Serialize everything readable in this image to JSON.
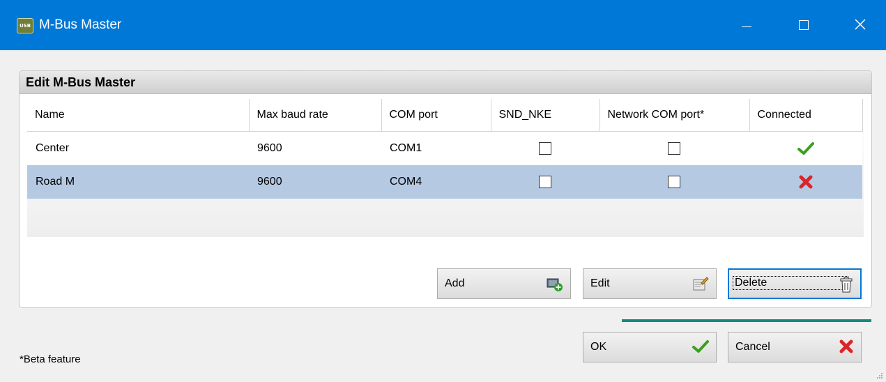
{
  "window": {
    "title": "M-Bus Master",
    "icon_text": "USB"
  },
  "panel": {
    "title": "Edit M-Bus Master"
  },
  "grid": {
    "columns": [
      "Name",
      "Max baud rate",
      "COM port",
      "SND_NKE",
      "Network COM port*",
      "Connected"
    ],
    "rows": [
      {
        "name": "Center",
        "baud": "9600",
        "port": "COM1",
        "snd_nke": false,
        "network": false,
        "connected": true
      },
      {
        "name": "Road M",
        "baud": "9600",
        "port": "COM4",
        "snd_nke": false,
        "network": false,
        "connected": false
      }
    ],
    "selected_row": 1
  },
  "buttons": {
    "add": "Add",
    "edit": "Edit",
    "delete": "Delete",
    "ok": "OK",
    "cancel": "Cancel"
  },
  "footnote": "*Beta feature",
  "colors": {
    "titlebar": "#0078d7",
    "selection": "#b5c9e3",
    "progress": "#128a7e",
    "connected_ok": "#3aa01c",
    "connected_fail": "#d9262b"
  },
  "icons": {
    "add": "add-device-icon",
    "edit": "edit-document-icon",
    "delete": "trash-icon",
    "ok": "green-check-icon",
    "cancel": "red-x-icon"
  }
}
